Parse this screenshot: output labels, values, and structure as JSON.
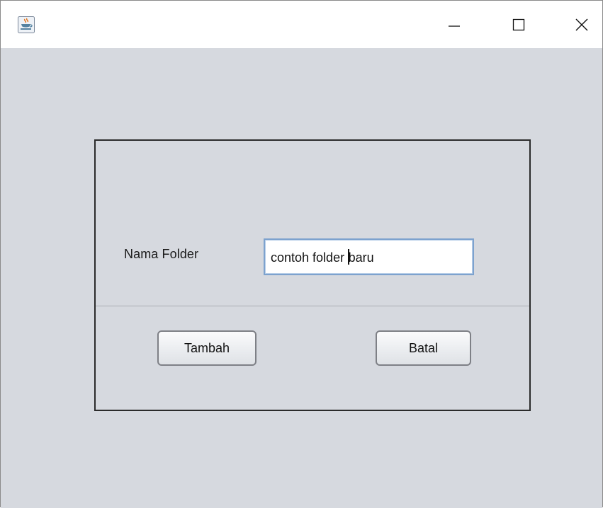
{
  "window": {
    "controls": {
      "minimize_icon": "minimize-icon",
      "maximize_icon": "maximize-icon",
      "close_icon": "close-icon"
    },
    "app_icon": "java-coffee-cup-icon"
  },
  "form": {
    "folder_name_label": "Nama Folder",
    "folder_name_value": "contoh folder baru",
    "folder_name_before_caret": "contoh folder ",
    "folder_name_after_caret": "baru"
  },
  "actions": {
    "add_label": "Tambah",
    "cancel_label": "Batal"
  },
  "colors": {
    "client_background": "#d6d9df",
    "field_focus_border": "#7da2ce"
  }
}
